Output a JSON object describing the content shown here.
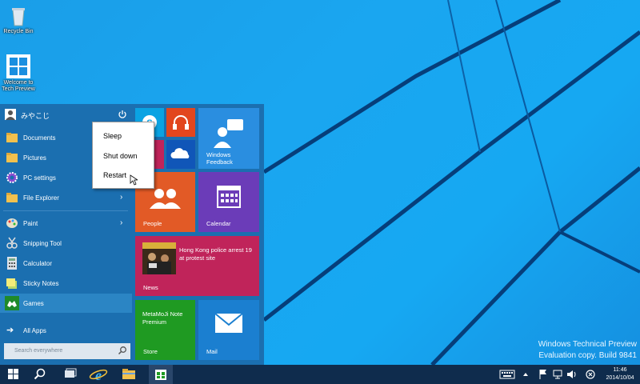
{
  "desktop": {
    "icons": [
      {
        "label": "Recycle Bin",
        "icon": "recycle-bin-icon"
      },
      {
        "label": "Welcome to Tech Preview",
        "icon": "windows-logo-icon"
      }
    ],
    "watermark": {
      "line1": "Windows Technical Preview",
      "line2": "Evaluation copy. Build 9841"
    }
  },
  "start_menu": {
    "user_name": "みやこじ",
    "items": [
      {
        "label": "Documents",
        "icon": "folder-icon"
      },
      {
        "label": "Pictures",
        "icon": "folder-icon"
      },
      {
        "label": "PC settings",
        "icon": "gear-icon"
      },
      {
        "label": "File Explorer",
        "icon": "folder-icon",
        "chevron": "›"
      },
      {
        "label": "Paint",
        "icon": "paint-palette-icon",
        "chevron": "›"
      },
      {
        "label": "Snipping Tool",
        "icon": "scissors-icon"
      },
      {
        "label": "Calculator",
        "icon": "calculator-icon"
      },
      {
        "label": "Sticky Notes",
        "icon": "sticky-notes-icon"
      },
      {
        "label": "Games",
        "icon": "gamepad-icon"
      }
    ],
    "all_apps": "All Apps",
    "search_placeholder": "Search everywhere",
    "tiles": {
      "windows_feedback": "Windows Feedback",
      "people": "People",
      "calendar": "Calendar",
      "news_headline": "Hong Kong police arrest 19 at protest site",
      "news": "News",
      "metamoji": "MetaMoJi Note Premium",
      "store": "Store",
      "mail": "Mail"
    }
  },
  "power_menu": {
    "items": [
      "Sleep",
      "Shut down",
      "Restart"
    ]
  },
  "taskbar": {
    "clock_time": "11:46",
    "clock_date": "2014/10/04"
  },
  "colors": {
    "desktop": "#1aa6f0",
    "start_bg": "#1b6fb0",
    "taskbar": "#0f2c4d",
    "people_tile": "#e25a26",
    "calendar_tile": "#6b3cb8",
    "news_tile": "#c0245a",
    "store_tile": "#1f9a22",
    "mail_tile": "#1b7fd0",
    "feedback_tile": "#2a8ee0"
  }
}
